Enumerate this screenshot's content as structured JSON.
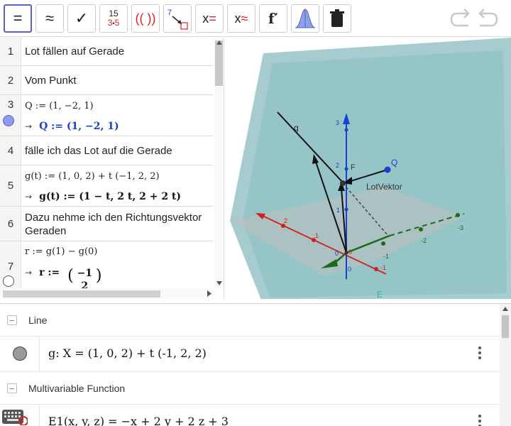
{
  "toolbar": {
    "tools": [
      {
        "name": "relation-tool",
        "label": "="
      },
      {
        "name": "numeric-tool",
        "label": "≈"
      },
      {
        "name": "keep-input-tool",
        "label": "✓"
      },
      {
        "name": "factor-tool",
        "label": "15 / 3·5"
      },
      {
        "name": "expand-tool",
        "label": "(( ))"
      },
      {
        "name": "substitute-tool",
        "label": "7"
      },
      {
        "name": "solve-tool",
        "label": "x="
      },
      {
        "name": "solve-numerically-tool",
        "label": "x≈"
      },
      {
        "name": "derivative-tool",
        "label": "f′"
      },
      {
        "name": "probability-tool",
        "label": "distribution"
      },
      {
        "name": "delete-tool",
        "label": "delete"
      }
    ],
    "factor_top": "15",
    "factor_bottom_a": "3",
    "factor_dot": "•",
    "factor_bottom_b": "5",
    "expand_label": "(( ))",
    "substitute_num": "7",
    "solve_x": "x",
    "solve_eq": "=",
    "solve_approx": "≈",
    "derivative_label": "f′",
    "relation_label": "=",
    "numeric_label": "≈",
    "check_label": "✓"
  },
  "cas": {
    "rows": [
      {
        "num": "1",
        "text": "Lot fällen auf Gerade"
      },
      {
        "num": "2",
        "text": "Vom Punkt"
      },
      {
        "num": "3",
        "input": "Q := (1, −2, 1)",
        "output_prefix": "→",
        "output": "Q := (1, −2, 1)"
      },
      {
        "num": "4",
        "text": "fälle ich das Lot auf die Gerade"
      },
      {
        "num": "5",
        "input": "g(t) := (1, 0, 2) + t (−1, 2, 2)",
        "output_prefix": "→",
        "output": "g(t) := (1 − t, 2 t, 2 + 2 t)"
      },
      {
        "num": "6",
        "text_line1": "Dazu nehme ich den Richtungsvektor",
        "text_line2": "Geraden"
      },
      {
        "num": "7",
        "input": "r := g(1) − g(0)",
        "output_prefix": "→",
        "output": "r :=",
        "matrix_top": "−1",
        "matrix_bottom": "2"
      }
    ]
  },
  "graphics3d": {
    "line_label": "g",
    "point_F_label": "F",
    "point_Q_label": "Q",
    "vector_label": "LotVektor",
    "plane_label": "E",
    "z_ticks": [
      "3",
      "2",
      "1",
      "0"
    ],
    "x_ticks": [
      "2",
      "1",
      "0",
      "-1"
    ],
    "y_ticks": [
      "-1",
      "-2",
      "-3"
    ],
    "origin_label": "0",
    "colors": {
      "plane": "#5fa3a7",
      "x_axis": "#d31f1f",
      "y_axis": "#1b6b1b",
      "z_axis": "#1a3fd1",
      "point_Q": "#1a3fd1",
      "point_F": "#333333"
    }
  },
  "algebra": {
    "groups": [
      {
        "name": "Line"
      },
      {
        "name": "Multivariable Function"
      }
    ],
    "items": [
      {
        "expr": "g: X = (1, 0, 2) + t (-1, 2, 2)",
        "marker_color": "#999999"
      },
      {
        "expr": "E1(x, y, z) = −x + 2 y + 2 z + 3",
        "marker_color": "#d22222"
      }
    ]
  }
}
